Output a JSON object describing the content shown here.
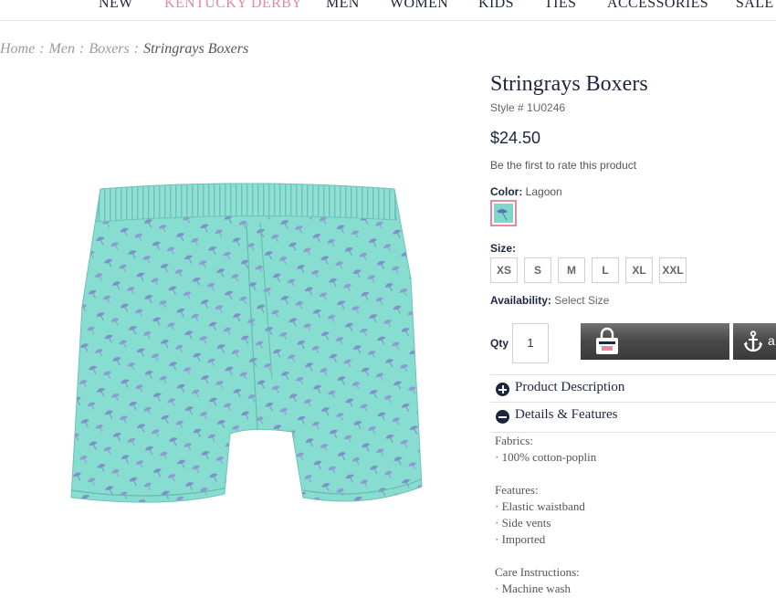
{
  "nav": {
    "items": [
      {
        "label": "NEW"
      },
      {
        "label": "KENTUCKY DERBY"
      },
      {
        "label": "MEN"
      },
      {
        "label": "WOMEN"
      },
      {
        "label": "KIDS"
      },
      {
        "label": "TIES"
      },
      {
        "label": "ACCESSORIES"
      },
      {
        "label": "SALE"
      }
    ]
  },
  "breadcrumb": {
    "items": [
      "Home",
      "Men",
      "Boxers"
    ],
    "separator": ":",
    "current": "Stringrays Boxers"
  },
  "product": {
    "title": "Stringrays Boxers",
    "style": "Style # 1U0246",
    "price": "$24.50",
    "rating_text": "Be the first to rate this product",
    "color_label": "Color:",
    "color_value": "Lagoon",
    "color_hex": "#7dd8cb",
    "size_label": "Size:",
    "sizes": [
      "XS",
      "S",
      "M",
      "L",
      "XL",
      "XXL"
    ],
    "availability_label": "Availability:",
    "availability_value": "Select Size",
    "qty_label": "Qty",
    "qty_value": "1",
    "wishlist_label": "a",
    "image_alt": "shopping-bag-icon"
  },
  "accordion": {
    "description_title": "Product Description",
    "details_title": "Details & Features"
  },
  "details": {
    "fabrics_heading": "Fabrics:",
    "fabrics": [
      "· 100% cotton-poplin"
    ],
    "features_heading": "Features:",
    "features": [
      "· Elastic waistband",
      "· Side vents",
      "· Imported"
    ],
    "care_heading": "Care Instructions:",
    "care": [
      "· Machine wash"
    ]
  },
  "colors": {
    "navy": "#1d2640",
    "pink": "#e8889c",
    "mint": "#7dd8cb"
  }
}
